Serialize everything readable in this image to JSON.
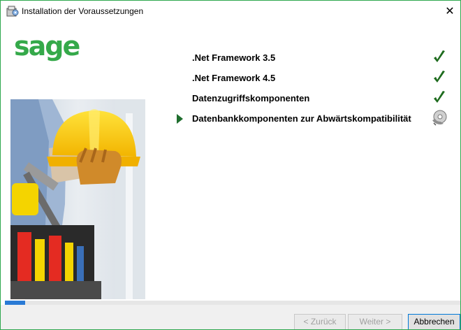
{
  "window": {
    "title": "Installation der Voraussetzungen",
    "close_glyph": "✕"
  },
  "brand": {
    "logo_text": "sage",
    "accent": "#35a94a"
  },
  "requirements": [
    {
      "label": ".Net Framework 3.5",
      "status": "done",
      "status_icon": "checkmark-icon"
    },
    {
      "label": ".Net Framework 4.5",
      "status": "done",
      "status_icon": "checkmark-icon"
    },
    {
      "label": "Datenzugriffskomponenten",
      "status": "done",
      "status_icon": "checkmark-icon"
    },
    {
      "label": "Datenbankkomponenten zur Abwärtskompatibilität",
      "status": "in-progress",
      "status_icon": "installing-disc-icon",
      "current": true
    }
  ],
  "progress": {
    "fraction": 0.045,
    "color": "#2a7ad5"
  },
  "buttons": {
    "back": "< Zurück",
    "next": "Weiter >",
    "cancel": "Abbrechen"
  }
}
